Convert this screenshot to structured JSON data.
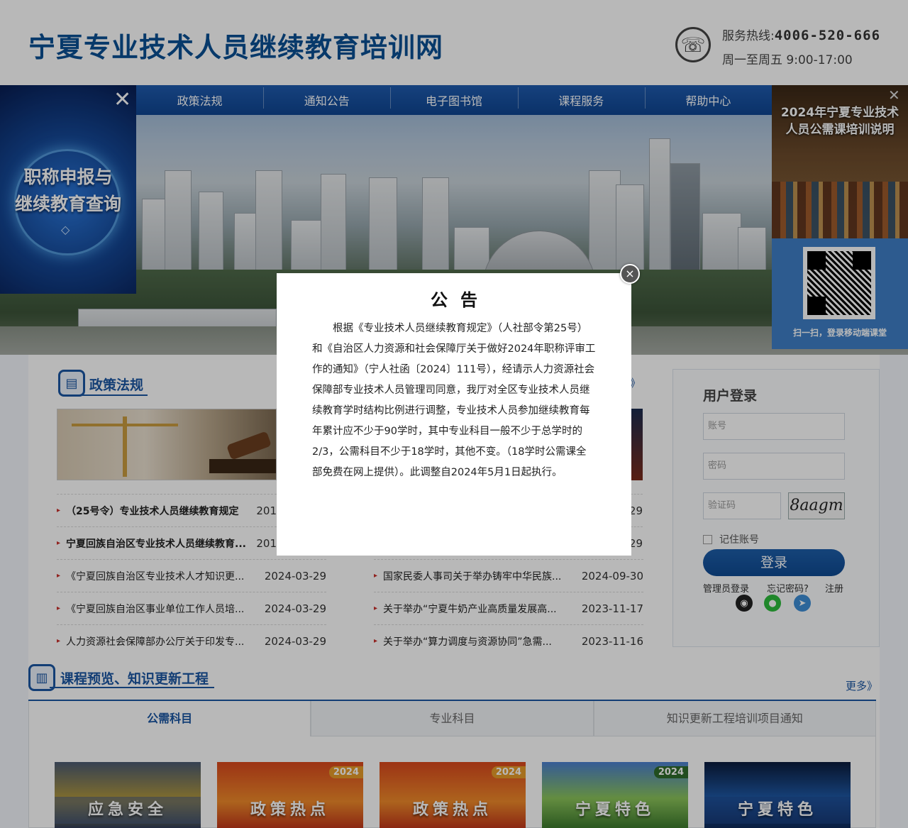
{
  "header": {
    "site_title": "宁夏专业技术人员继续教育培训网",
    "hotline_label": "服务热线:",
    "hotline_number": "4006-520-666",
    "hours": "周一至周五 9:00-17:00"
  },
  "nav": {
    "items": [
      "政策法规",
      "通知公告",
      "电子图书馆",
      "课程服务",
      "帮助中心"
    ]
  },
  "left_ad": {
    "line1": "职称申报与",
    "line2": "继续教育查询",
    "close": "✕",
    "gem": "◇"
  },
  "right_ad": {
    "title1": "2024年宁夏专业技术",
    "title2": "人员公需课培训说明",
    "close": "✕",
    "qr_caption": "扫一扫，登录移动端课堂"
  },
  "policy": {
    "title": "政策法规",
    "more": "》",
    "left_list": [
      {
        "title": "（25号令）专业技术人员继续教育规定",
        "date": "201",
        "bold": true
      },
      {
        "title": "宁夏回族自治区专业技术人员继续教育...",
        "date": "201",
        "bold": true
      },
      {
        "title": "《宁夏回族自治区专业技术人才知识更...",
        "date": "2024-03-29",
        "bold": false
      },
      {
        "title": "《宁夏回族自治区事业单位工作人员培...",
        "date": "2024-03-29",
        "bold": false
      },
      {
        "title": "人力资源社会保障部办公厅关于印发专...",
        "date": "2024-03-29",
        "bold": false
      }
    ],
    "right_list": [
      {
        "title": "",
        "date": "29"
      },
      {
        "title": "",
        "date": "29"
      },
      {
        "title": "国家民委人事司关于举办铸牢中华民族...",
        "date": "2024-09-30"
      },
      {
        "title": "关于举办“宁夏牛奶产业高质量发展高...",
        "date": "2023-11-17"
      },
      {
        "title": "关于举办“算力调度与资源协同”急需...",
        "date": "2023-11-16"
      }
    ]
  },
  "login": {
    "title": "用户登录",
    "account_placeholder": "账号",
    "password_placeholder": "密码",
    "captcha_placeholder": "验证码",
    "captcha_text": "8aagm",
    "remember": "记住账号",
    "button": "登录",
    "admin_login": "管理员登录",
    "forgot": "忘记密码?",
    "register": "注册"
  },
  "courses": {
    "title": "课程预览、知识更新工程",
    "more": "更多》",
    "tabs": [
      "公需科目",
      "专业科目",
      "知识更新工程培训项目通知"
    ],
    "cards": [
      {
        "caption": "应急安全",
        "year": ""
      },
      {
        "caption": "政策热点",
        "year": "2024"
      },
      {
        "caption": "政策热点",
        "year": "2024"
      },
      {
        "caption": "宁夏特色",
        "year": "2024"
      },
      {
        "caption": "宁夏特色",
        "year": ""
      }
    ]
  },
  "modal": {
    "title": "公告",
    "body": "根据《专业技术人员继续教育规定》（人社部令第25号）和《自治区人力资源和社会保障厅关于做好2024年职称评审工作的通知》（宁人社函〔2024〕111号），经请示人力资源社会保障部专业技术人员管理司同意，我厅对全区专业技术人员继续教育学时结构比例进行调整，专业技术人员参加继续教育每年累计应不少于90学时，其中专业科目一般不少于总学时的2/3，公需科目不少于18学时，其他不变。（18学时公需课全部免费在网上提供）。此调整自2024年5月1日起执行。",
    "close": "×"
  },
  "colors": {
    "brand": "#0b4f94",
    "nav": "#1b56a3",
    "login_button": "#0e4a92"
  }
}
